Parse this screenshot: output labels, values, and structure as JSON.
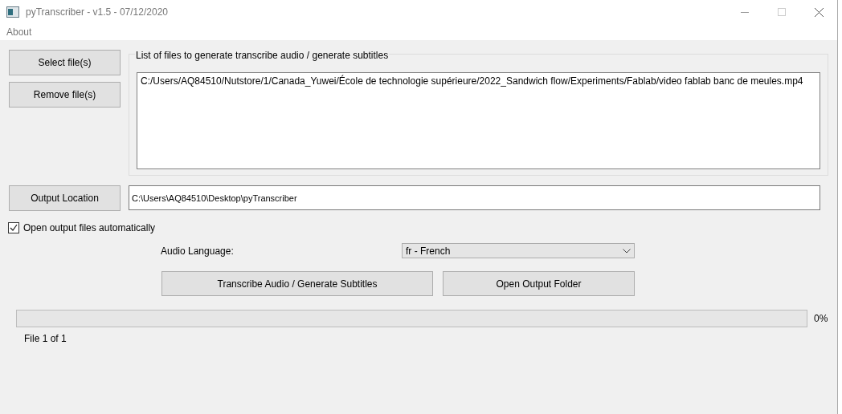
{
  "window": {
    "title": "pyTranscriber - v1.5 - 07/12/2020"
  },
  "menu": [
    "About"
  ],
  "file_buttons": [
    "Select file(s)",
    "Remove file(s)"
  ],
  "file_list": {
    "title": "List of files to generate transcribe audio / generate subtitles",
    "items": [
      "C:/Users/AQ84510/Nutstore/1/Canada_Yuwei/École de technologie supérieure/2022_Sandwich flow/Experiments/Fablab/video fablab banc de meules.mp4"
    ]
  },
  "output": {
    "button": "Output Location",
    "value": "C:\\Users\\AQ84510\\Desktop\\pyTranscriber"
  },
  "open_automatically": {
    "label": "Open output files automatically",
    "checked": true
  },
  "language": {
    "label": "Audio Language:",
    "value": "fr - French"
  },
  "actions": [
    "Transcribe Audio / Generate Subtitles",
    "Open Output Folder"
  ],
  "progress": {
    "level": 0,
    "reading": "0%",
    "status": "File 1 of 1"
  }
}
